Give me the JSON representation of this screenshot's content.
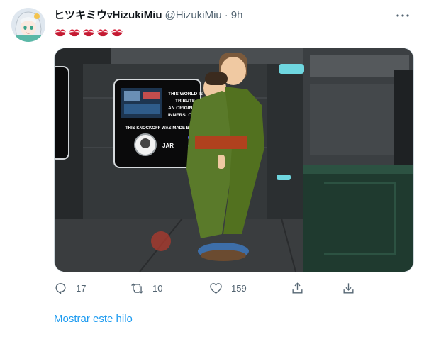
{
  "tweet": {
    "display_name": "ヒツキミウ▿HizukiMiu",
    "handle": "@HizukiMiu",
    "separator": "·",
    "time": "9h",
    "text_emoji": "kiss-mark-icon",
    "text_emoji_count": 5
  },
  "media": {
    "poster_heading": "THIS WORLD IS TRIBUTE AN ORIGINAL INNERSLOTH",
    "poster_credit": "THIS KNOCKOFF WAS MADE BY:",
    "poster_author": "JAR",
    "colors": {
      "wall": "#2e3133",
      "floor": "#3a3d3f",
      "kimono": "#5a7a2a",
      "obi": "#b0411e",
      "console": "#1f3a2f"
    }
  },
  "actions": {
    "reply_count": "17",
    "retweet_count": "10",
    "like_count": "159"
  },
  "show_thread_label": "Mostrar este hilo"
}
